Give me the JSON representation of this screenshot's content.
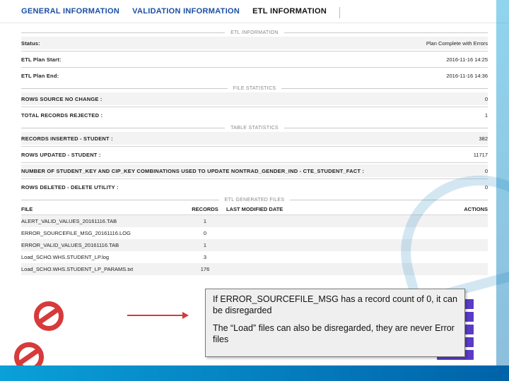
{
  "tabs": {
    "t0": "GENERAL INFORMATION",
    "t1": "VALIDATION INFORMATION",
    "t2": "ETL INFORMATION"
  },
  "sections": {
    "etl_info": "ETL INFORMATION",
    "file_stats": "FILE STATISTICS",
    "table_stats": "TABLE STATISTICS",
    "gen_files": "ETL GENERATED FILES"
  },
  "etl": {
    "status_k": "Status:",
    "status_v": "Plan Complete with Errors",
    "start_k": "ETL Plan Start:",
    "start_v": "2016-11-16  14:25",
    "end_k": "ETL Plan End:",
    "end_v": "2016-11-16  14:36"
  },
  "fstats": {
    "r0k": "ROWS SOURCE NO CHANGE :",
    "r0v": "0",
    "r1k": "TOTAL RECORDS REJECTED :",
    "r1v": "1"
  },
  "tstats": {
    "r0k": "RECORDS INSERTED - STUDENT :",
    "r0v": "382",
    "r1k": "ROWS UPDATED - STUDENT :",
    "r1v": "11717",
    "r2k": "NUMBER OF STUDENT_KEY AND CIP_KEY COMBINATIONS USED TO UPDATE NONTRAD_GENDER_IND - CTE_STUDENT_FACT :",
    "r2v": "0",
    "r3k": "ROWS DELETED - DELETE UTILITY :",
    "r3v": "0"
  },
  "files": {
    "h1": "FILE",
    "h2": "RECORDS",
    "h3": "LAST MODIFIED DATE",
    "h4": "ACTIONS",
    "r0f": "ALERT_VALID_VALUES_20161116.TAB",
    "r0c": "1",
    "r1f": "ERROR_SOURCEFILE_MSG_20161116.LOG",
    "r1c": "0",
    "r2f": "ERROR_VALID_VALUES_20161116.TAB",
    "r2c": "1",
    "r3f": "Load_SCHO.WHS.STUDENT_LP.log",
    "r3c": "3",
    "r4f": "Load_SCHO.WHS.STUDENT_LP_PARAMS.txt",
    "r4c": "176"
  },
  "callout": {
    "p1": "If ERROR_SOURCEFILE_MSG  has a record count of 0, it can be disregarded",
    "p2": "The “Load” files can also be disregarded, they are never Error files"
  }
}
